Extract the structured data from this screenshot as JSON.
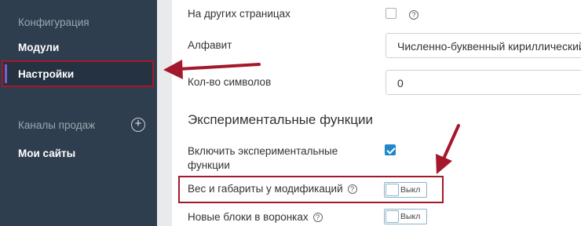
{
  "sidebar": {
    "heading_config": "Конфигурация",
    "item_modules": "Модули",
    "item_settings": "Настройки",
    "heading_sales": "Каналы продаж",
    "item_my_sites": "Мои сайты",
    "add_icon": "plus-circle"
  },
  "content": {
    "other_pages_label": "На других страницах",
    "other_pages_checked": false,
    "alphabet_label": "Алфавит",
    "alphabet_value": "Численно-буквенный кириллический",
    "char_count_label": "Кол-во символов",
    "char_count_value": "0",
    "section_title": "Экспериментальные функции",
    "exp_enable_label": "Включить экспериментальные функции",
    "exp_enable_checked": true,
    "weight_label": "Вес и габариты у модификаций",
    "weight_toggle_state": "Выкл",
    "funnel_label": "Новые блоки в воронках",
    "funnel_toggle_state": "Выкл",
    "help_glyph": "?"
  },
  "colors": {
    "sidebar_bg": "#2f3e4e",
    "annotation_red": "#a4182c",
    "checkbox_blue": "#1e88c9"
  }
}
